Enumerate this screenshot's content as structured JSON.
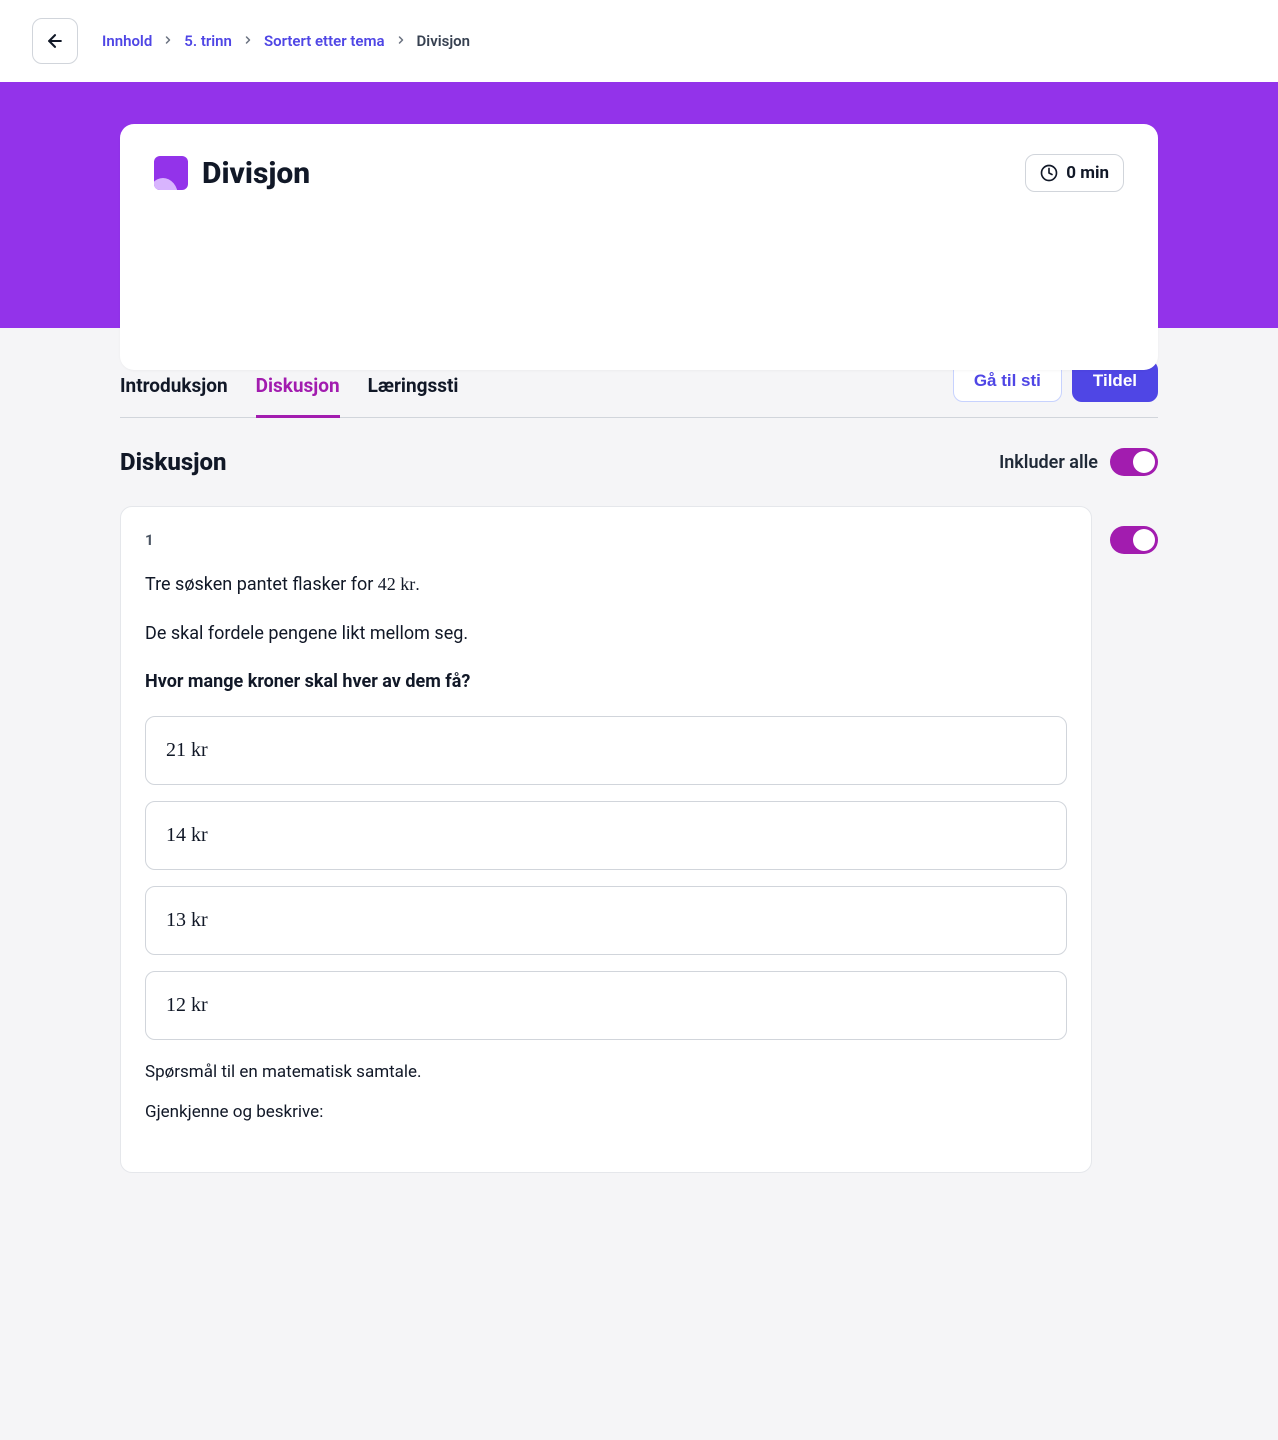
{
  "breadcrumb": {
    "items": [
      {
        "label": "Innhold",
        "link": true
      },
      {
        "label": "5. trinn",
        "link": true
      },
      {
        "label": "Sortert etter tema",
        "link": true
      },
      {
        "label": "Divisjon",
        "link": false
      }
    ]
  },
  "header": {
    "title": "Divisjon",
    "duration": "0 min"
  },
  "tabs": {
    "items": [
      "Introduksjon",
      "Diskusjon",
      "Læringssti"
    ],
    "active_index": 1,
    "actions": {
      "go_to_path": "Gå til sti",
      "assign": "Tildel"
    }
  },
  "section": {
    "title": "Diskusjon",
    "include_all_label": "Inkluder alle"
  },
  "question": {
    "number": "1",
    "line1_pre": "Tre søsken pantet flasker for ",
    "line1_val": "42 kr",
    "line1_post": ".",
    "line2": "De skal fordele pengene likt mellom seg.",
    "prompt": "Hvor mange kroner skal hver av dem få?",
    "answers": [
      "21 kr",
      "14 kr",
      "13 kr",
      "12 kr"
    ],
    "footnote1": "Spørsmål til en matematisk samtale.",
    "footnote2": "Gjenkjenne og beskrive:"
  }
}
